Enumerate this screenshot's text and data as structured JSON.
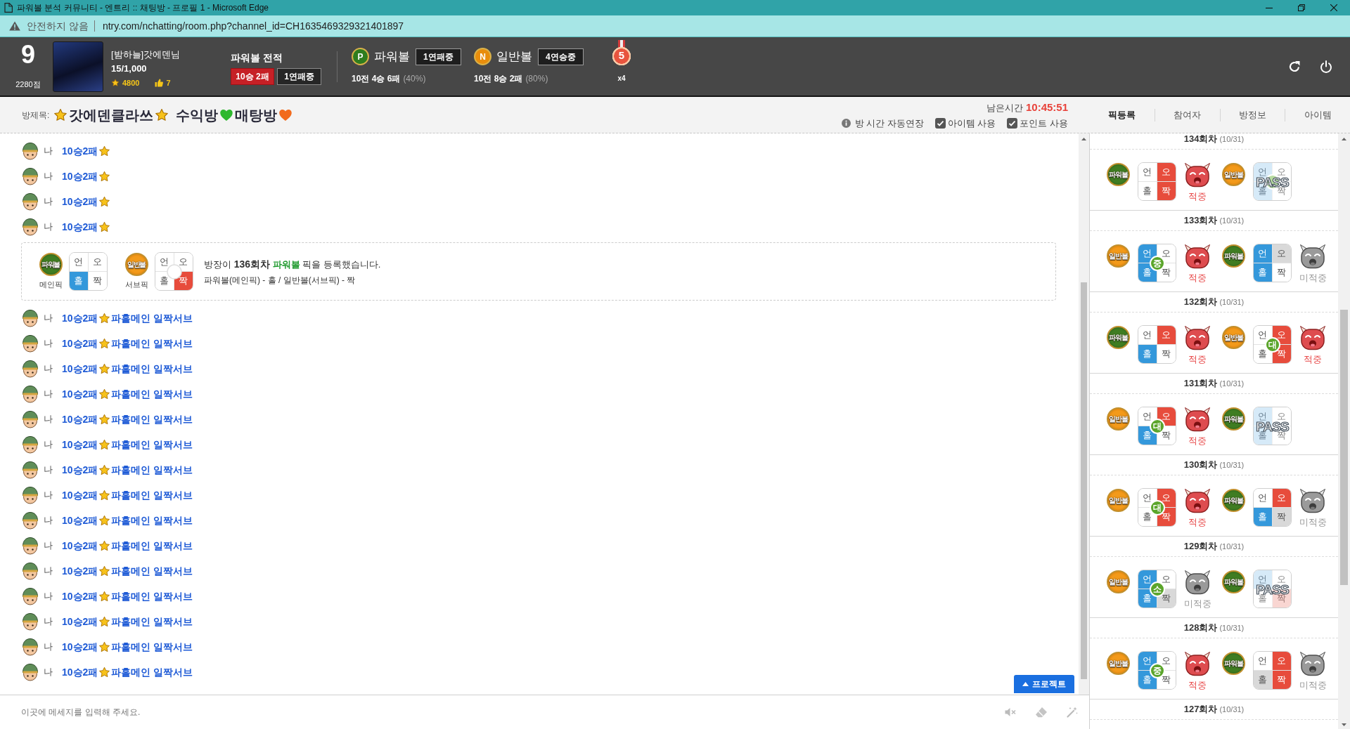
{
  "window": {
    "title": "파워볼 분석 커뮤니티 - 엔트리 :: 채팅방 - 프로필 1 - Microsoft Edge"
  },
  "address_bar": {
    "security": "안전하지 않음",
    "url": "ntry.com/nchatting/room.php?channel_id=CH1635469329321401897"
  },
  "profile": {
    "rank": "9",
    "points": "2280점",
    "name": "[밤하늘]갓에덴님",
    "count": "15/1,000",
    "star_points": "4800",
    "likes": "7"
  },
  "record": {
    "title": "파워볼 전적",
    "result": "10승 2패",
    "streak": "1연패중"
  },
  "games": [
    {
      "kind": "power",
      "badge": "P",
      "name": "파워볼",
      "streak": "1연패중",
      "summary": "10전 4승 6패",
      "rate": "(40%)"
    },
    {
      "kind": "normal",
      "badge": "N",
      "name": "일반볼",
      "streak": "4연승중",
      "summary": "10전 8승 2패",
      "rate": "(80%)"
    }
  ],
  "medal": {
    "number": "5",
    "count": "x4"
  },
  "room": {
    "label": "방제목:",
    "title": [
      {
        "kind": "star"
      },
      {
        "kind": "text",
        "text": "갓에덴클라쓰"
      },
      {
        "kind": "star"
      },
      {
        "kind": "text",
        "text": "수익방"
      },
      {
        "kind": "heart",
        "color": "#2eb82e"
      },
      {
        "kind": "text",
        "text": "매탕방"
      },
      {
        "kind": "heart",
        "color": "#f26b1d"
      }
    ],
    "time_label": "남은시간",
    "time": "10:45:51",
    "auto_extend": "방 시간 자동연장",
    "options": [
      {
        "label": "아이템 사용",
        "checked": true
      },
      {
        "label": "포인트 사용",
        "checked": true
      }
    ]
  },
  "tabs": [
    {
      "label": "픽등록",
      "selected": true
    },
    {
      "label": "참여자",
      "selected": false
    },
    {
      "label": "방정보",
      "selected": false
    },
    {
      "label": "아이템",
      "selected": false
    }
  ],
  "chat": [
    {
      "kind": "message",
      "sender": "나",
      "text": "10승2패",
      "star": true
    },
    {
      "kind": "message",
      "sender": "나",
      "text": "10승2패",
      "star": true
    },
    {
      "kind": "message",
      "sender": "나",
      "text": "10승2패",
      "star": true
    },
    {
      "kind": "message",
      "sender": "나",
      "text": "10승2패",
      "star": true
    },
    {
      "kind": "pick",
      "picks": [
        {
          "emblem": {
            "kind": "power",
            "text": "파워볼"
          },
          "label": "메인픽",
          "grid": {
            "cells": [
              {
                "text": "언",
                "selected": false,
                "dimmed": false
              },
              {
                "text": "오",
                "selected": false,
                "dimmed": false
              },
              {
                "text": "홀",
                "selected": true,
                "dimmed": false
              },
              {
                "text": "짝",
                "selected": false,
                "dimmed": false
              }
            ]
          }
        },
        {
          "emblem": {
            "kind": "normal",
            "text": "일반볼"
          },
          "label": "서브픽",
          "grid": {
            "cells": [
              {
                "text": "언",
                "selected": false,
                "dimmed": false
              },
              {
                "text": "오",
                "selected": false,
                "dimmed": false
              },
              {
                "text": "홀",
                "selected": false,
                "dimmed": false
              },
              {
                "text": "짝",
                "selected": true,
                "dimmed": false
              }
            ],
            "center": {
              "kind": "empty"
            }
          }
        }
      ],
      "notice": [
        {
          "kind": "plain",
          "text": "방장이"
        },
        {
          "kind": "bold",
          "text": "136회차"
        },
        {
          "kind": "game",
          "text": "파워볼"
        },
        {
          "kind": "plain",
          "text": "픽을 등록했습니다."
        }
      ],
      "detail": "파워볼(메인픽) - 홀 / 일반볼(서브픽) - 짝"
    },
    {
      "kind": "message",
      "sender": "나",
      "text": "10승2패",
      "star": true,
      "text_after": "파홀메인 일짝서브"
    },
    {
      "kind": "message",
      "sender": "나",
      "text": "10승2패",
      "star": true,
      "text_after": "파홀메인 일짝서브"
    },
    {
      "kind": "message",
      "sender": "나",
      "text": "10승2패",
      "star": true,
      "text_after": "파홀메인 일짝서브"
    },
    {
      "kind": "message",
      "sender": "나",
      "text": "10승2패",
      "star": true,
      "text_after": "파홀메인 일짝서브"
    },
    {
      "kind": "message",
      "sender": "나",
      "text": "10승2패",
      "star": true,
      "text_after": "파홀메인 일짝서브"
    },
    {
      "kind": "message",
      "sender": "나",
      "text": "10승2패",
      "star": true,
      "text_after": "파홀메인 일짝서브"
    },
    {
      "kind": "message",
      "sender": "나",
      "text": "10승2패",
      "star": true,
      "text_after": "파홀메인 일짝서브"
    },
    {
      "kind": "message",
      "sender": "나",
      "text": "10승2패",
      "star": true,
      "text_after": "파홀메인 일짝서브"
    },
    {
      "kind": "message",
      "sender": "나",
      "text": "10승2패",
      "star": true,
      "text_after": "파홀메인 일짝서브"
    },
    {
      "kind": "message",
      "sender": "나",
      "text": "10승2패",
      "star": true,
      "text_after": "파홀메인 일짝서브"
    },
    {
      "kind": "message",
      "sender": "나",
      "text": "10승2패",
      "star": true,
      "text_after": "파홀메인 일짝서브"
    },
    {
      "kind": "message",
      "sender": "나",
      "text": "10승2패",
      "star": true,
      "text_after": "파홀메인 일짝서브"
    },
    {
      "kind": "message",
      "sender": "나",
      "text": "10승2패",
      "star": true,
      "text_after": "파홀메인 일짝서브"
    },
    {
      "kind": "message",
      "sender": "나",
      "text": "10승2패",
      "star": true,
      "text_after": "파홀메인 일짝서브"
    },
    {
      "kind": "message",
      "sender": "나",
      "text": "10승2패",
      "star": true,
      "text_after": "파홀메인 일짝서브"
    }
  ],
  "project_button": "프로젝트",
  "input": {
    "placeholder": "이곳에 메세지를 입력해 주세요."
  },
  "rounds": [
    {
      "title": "134회차",
      "date": "(10/31)",
      "picks": [
        {
          "emblem": {
            "kind": "power",
            "text": "파워볼"
          },
          "grid": {
            "cells": [
              {
                "text": "언",
                "selected": false,
                "dimmed": false
              },
              {
                "text": "오",
                "selected": true,
                "dimmed": false
              },
              {
                "text": "홀",
                "selected": false,
                "dimmed": false
              },
              {
                "text": "짝",
                "selected": true,
                "dimmed": false
              }
            ]
          },
          "result": {
            "kind": "hit",
            "text": "적중"
          }
        },
        {
          "emblem": {
            "kind": "normal",
            "text": "일반볼"
          },
          "grid": {
            "cells": [
              {
                "text": "언",
                "selected": true,
                "dimmed": false
              },
              {
                "text": "오",
                "selected": false,
                "dimmed": false
              },
              {
                "text": "홀",
                "selected": true,
                "dimmed": false
              },
              {
                "text": "짝",
                "selected": false,
                "dimmed": false
              }
            ],
            "center": {
              "kind": "covered"
            },
            "pass": "PASS"
          }
        }
      ]
    },
    {
      "title": "133회차",
      "date": "(10/31)",
      "picks": [
        {
          "emblem": {
            "kind": "normal",
            "text": "일반볼"
          },
          "grid": {
            "cells": [
              {
                "text": "언",
                "selected": true,
                "dimmed": false
              },
              {
                "text": "오",
                "selected": false,
                "dimmed": false
              },
              {
                "text": "홀",
                "selected": true,
                "dimmed": false
              },
              {
                "text": "짝",
                "selected": false,
                "dimmed": false
              }
            ],
            "center": {
              "kind": "size",
              "text": "중"
            }
          },
          "result": {
            "kind": "hit",
            "text": "적중"
          }
        },
        {
          "emblem": {
            "kind": "power",
            "text": "파워볼"
          },
          "grid": {
            "cells": [
              {
                "text": "언",
                "selected": true,
                "dimmed": false
              },
              {
                "text": "오",
                "selected": false,
                "dimmed": true
              },
              {
                "text": "홀",
                "selected": true,
                "dimmed": false
              },
              {
                "text": "짝",
                "selected": false,
                "dimmed": false
              }
            ]
          },
          "result": {
            "kind": "miss",
            "text": "미적중"
          }
        }
      ]
    },
    {
      "title": "132회차",
      "date": "(10/31)",
      "picks": [
        {
          "emblem": {
            "kind": "power",
            "text": "파워볼"
          },
          "grid": {
            "cells": [
              {
                "text": "언",
                "selected": false,
                "dimmed": false
              },
              {
                "text": "오",
                "selected": true,
                "dimmed": false
              },
              {
                "text": "홀",
                "selected": true,
                "dimmed": false
              },
              {
                "text": "짝",
                "selected": false,
                "dimmed": false
              }
            ]
          },
          "result": {
            "kind": "hit",
            "text": "적중"
          }
        },
        {
          "emblem": {
            "kind": "normal",
            "text": "일반볼"
          },
          "grid": {
            "cells": [
              {
                "text": "언",
                "selected": false,
                "dimmed": false
              },
              {
                "text": "오",
                "selected": true,
                "dimmed": false
              },
              {
                "text": "홀",
                "selected": false,
                "dimmed": false
              },
              {
                "text": "짝",
                "selected": true,
                "dimmed": false
              }
            ],
            "center": {
              "kind": "size",
              "text": "대"
            }
          },
          "result": {
            "kind": "hit",
            "text": "적중"
          }
        }
      ]
    },
    {
      "title": "131회차",
      "date": "(10/31)",
      "picks": [
        {
          "emblem": {
            "kind": "normal",
            "text": "일반볼"
          },
          "grid": {
            "cells": [
              {
                "text": "언",
                "selected": false,
                "dimmed": false
              },
              {
                "text": "오",
                "selected": true,
                "dimmed": false
              },
              {
                "text": "홀",
                "selected": true,
                "dimmed": false
              },
              {
                "text": "짝",
                "selected": false,
                "dimmed": false
              }
            ],
            "center": {
              "kind": "size",
              "text": "대"
            }
          },
          "result": {
            "kind": "hit",
            "text": "적중"
          }
        },
        {
          "emblem": {
            "kind": "power",
            "text": "파워볼"
          },
          "grid": {
            "cells": [
              {
                "text": "언",
                "selected": true,
                "dimmed": false
              },
              {
                "text": "오",
                "selected": false,
                "dimmed": false
              },
              {
                "text": "홀",
                "selected": true,
                "dimmed": false
              },
              {
                "text": "짝",
                "selected": false,
                "dimmed": false
              }
            ],
            "pass": "PASS"
          }
        }
      ]
    },
    {
      "title": "130회차",
      "date": "(10/31)",
      "picks": [
        {
          "emblem": {
            "kind": "normal",
            "text": "일반볼"
          },
          "grid": {
            "cells": [
              {
                "text": "언",
                "selected": false,
                "dimmed": false
              },
              {
                "text": "오",
                "selected": true,
                "dimmed": false
              },
              {
                "text": "홀",
                "selected": false,
                "dimmed": false
              },
              {
                "text": "짝",
                "selected": true,
                "dimmed": false
              }
            ],
            "center": {
              "kind": "size",
              "text": "대"
            }
          },
          "result": {
            "kind": "hit",
            "text": "적중"
          }
        },
        {
          "emblem": {
            "kind": "power",
            "text": "파워볼"
          },
          "grid": {
            "cells": [
              {
                "text": "언",
                "selected": false,
                "dimmed": false
              },
              {
                "text": "오",
                "selected": true,
                "dimmed": false
              },
              {
                "text": "홀",
                "selected": true,
                "dimmed": false
              },
              {
                "text": "짝",
                "selected": false,
                "dimmed": true
              }
            ]
          },
          "result": {
            "kind": "miss",
            "text": "미적중"
          }
        }
      ]
    },
    {
      "title": "129회차",
      "date": "(10/31)",
      "picks": [
        {
          "emblem": {
            "kind": "normal",
            "text": "일반볼"
          },
          "grid": {
            "cells": [
              {
                "text": "언",
                "selected": true,
                "dimmed": false
              },
              {
                "text": "오",
                "selected": false,
                "dimmed": false
              },
              {
                "text": "홀",
                "selected": true,
                "dimmed": false
              },
              {
                "text": "짝",
                "selected": false,
                "dimmed": true
              }
            ],
            "center": {
              "kind": "size",
              "text": "소"
            }
          },
          "result": {
            "kind": "miss",
            "text": "미적중"
          }
        },
        {
          "emblem": {
            "kind": "power",
            "text": "파워볼"
          },
          "grid": {
            "cells": [
              {
                "text": "언",
                "selected": true,
                "dimmed": false
              },
              {
                "text": "오",
                "selected": false,
                "dimmed": false
              },
              {
                "text": "홀",
                "selected": false,
                "dimmed": false
              },
              {
                "text": "짝",
                "selected": true,
                "dimmed": false
              }
            ],
            "pass": "PASS"
          }
        }
      ]
    },
    {
      "title": "128회차",
      "date": "(10/31)",
      "picks": [
        {
          "emblem": {
            "kind": "normal",
            "text": "일반볼"
          },
          "grid": {
            "cells": [
              {
                "text": "언",
                "selected": true,
                "dimmed": false
              },
              {
                "text": "오",
                "selected": false,
                "dimmed": false
              },
              {
                "text": "홀",
                "selected": true,
                "dimmed": false
              },
              {
                "text": "짝",
                "selected": false,
                "dimmed": false
              }
            ],
            "center": {
              "kind": "size",
              "text": "중"
            }
          },
          "result": {
            "kind": "hit",
            "text": "적중"
          }
        },
        {
          "emblem": {
            "kind": "power",
            "text": "파워볼"
          },
          "grid": {
            "cells": [
              {
                "text": "언",
                "selected": false,
                "dimmed": false
              },
              {
                "text": "오",
                "selected": true,
                "dimmed": false
              },
              {
                "text": "홀",
                "selected": false,
                "dimmed": true
              },
              {
                "text": "짝",
                "selected": true,
                "dimmed": false
              }
            ]
          },
          "result": {
            "kind": "miss",
            "text": "미적중"
          }
        }
      ]
    },
    {
      "title": "127회차",
      "date": "(10/31)"
    }
  ]
}
